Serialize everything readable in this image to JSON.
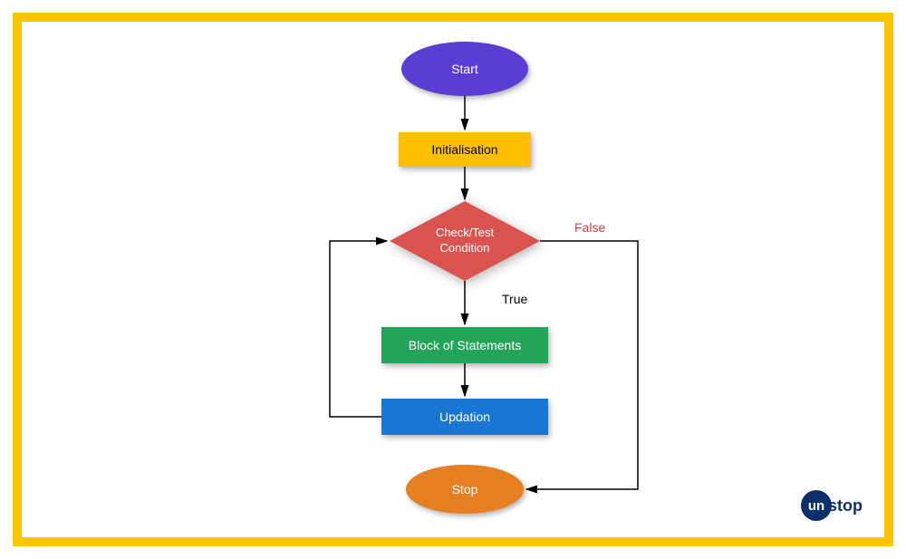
{
  "nodes": {
    "start": "Start",
    "init": "Initialisation",
    "condition_line1": "Check/Test",
    "condition_line2": "Condition",
    "block": "Block of Statements",
    "updation": "Updation",
    "stop": "Stop"
  },
  "edges": {
    "true_label": "True",
    "false_label": "False"
  },
  "colors": {
    "frame": "#fdc500",
    "start": "#5b3dd3",
    "init": "#fdbf00",
    "decision": "#d9534f",
    "block": "#23a45a",
    "updation": "#1976d2",
    "stop": "#e67e22",
    "false_text": "#c94141"
  },
  "logo": {
    "left": "un",
    "right": "stop"
  }
}
